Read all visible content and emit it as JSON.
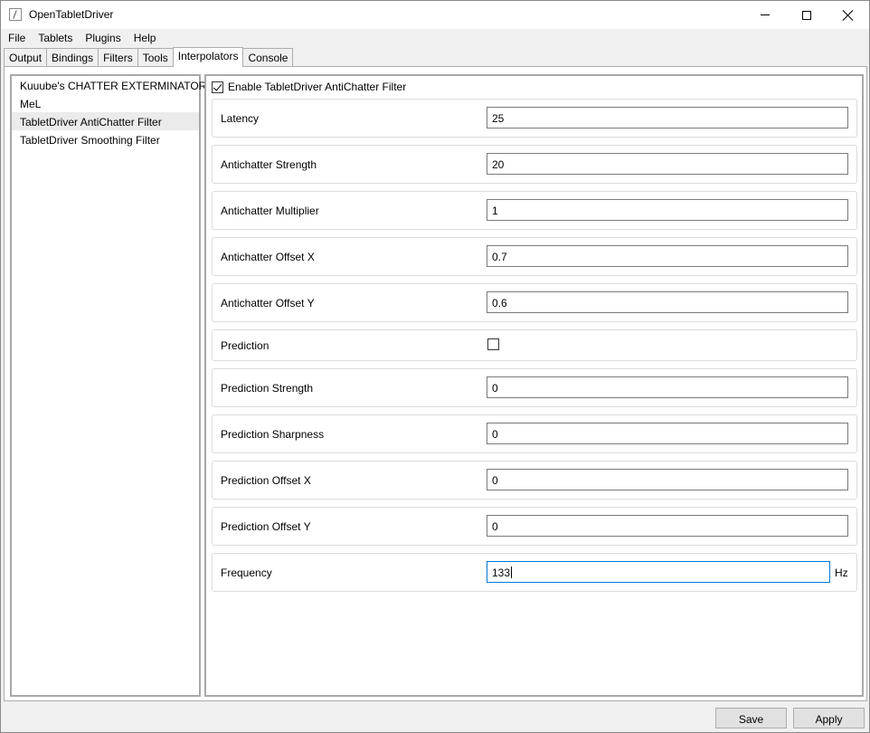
{
  "window": {
    "title": "OpenTabletDriver"
  },
  "menu": [
    "File",
    "Tablets",
    "Plugins",
    "Help"
  ],
  "tabs": [
    {
      "label": "Output",
      "active": false
    },
    {
      "label": "Bindings",
      "active": false
    },
    {
      "label": "Filters",
      "active": false
    },
    {
      "label": "Tools",
      "active": false
    },
    {
      "label": "Interpolators",
      "active": true
    },
    {
      "label": "Console",
      "active": false
    }
  ],
  "plugins": [
    {
      "label": "Kuuube's CHATTER EXTERMINATOR",
      "selected": false
    },
    {
      "label": "MeL",
      "selected": false
    },
    {
      "label": "TabletDriver AntiChatter Filter",
      "selected": true
    },
    {
      "label": "TabletDriver Smoothing Filter",
      "selected": false
    }
  ],
  "settings": {
    "enable_label": "Enable TabletDriver AntiChatter Filter",
    "enabled": true,
    "latency": {
      "label": "Latency",
      "value": "25"
    },
    "antichatter_strength": {
      "label": "Antichatter Strength",
      "value": "20"
    },
    "antichatter_multiplier": {
      "label": "Antichatter Multiplier",
      "value": "1"
    },
    "antichatter_offset_x": {
      "label": "Antichatter Offset X",
      "value": "0.7"
    },
    "antichatter_offset_y": {
      "label": "Antichatter Offset Y",
      "value": "0.6"
    },
    "prediction": {
      "label": "Prediction",
      "checked": false
    },
    "prediction_strength": {
      "label": "Prediction Strength",
      "value": "0"
    },
    "prediction_sharpness": {
      "label": "Prediction Sharpness",
      "value": "0"
    },
    "prediction_offset_x": {
      "label": "Prediction Offset X",
      "value": "0"
    },
    "prediction_offset_y": {
      "label": "Prediction Offset Y",
      "value": "0"
    },
    "frequency": {
      "label": "Frequency",
      "value": "133",
      "unit": "Hz"
    }
  },
  "footer": {
    "save_label": "Save",
    "apply_label": "Apply"
  }
}
